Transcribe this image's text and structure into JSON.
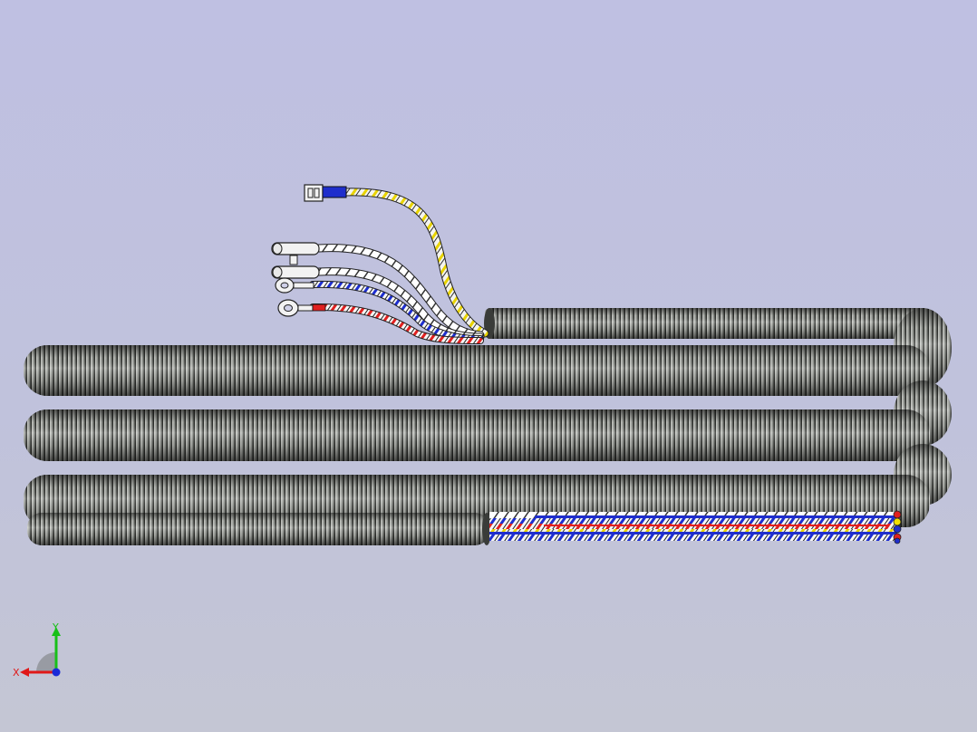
{
  "viewport": {
    "background_top": "#bfc0e2",
    "background_bottom": "#c4c6d4"
  },
  "model": {
    "conduit_color": "#6e716c",
    "wire_colors": [
      "#1f2ecc",
      "#e02020",
      "#f2e000",
      "#ffffff"
    ],
    "loop_count": 3
  },
  "triad": {
    "x_label": "X",
    "y_label": "Y",
    "x_color": "#e01818",
    "y_color": "#18c018",
    "z_color": "#1a2ad8"
  }
}
